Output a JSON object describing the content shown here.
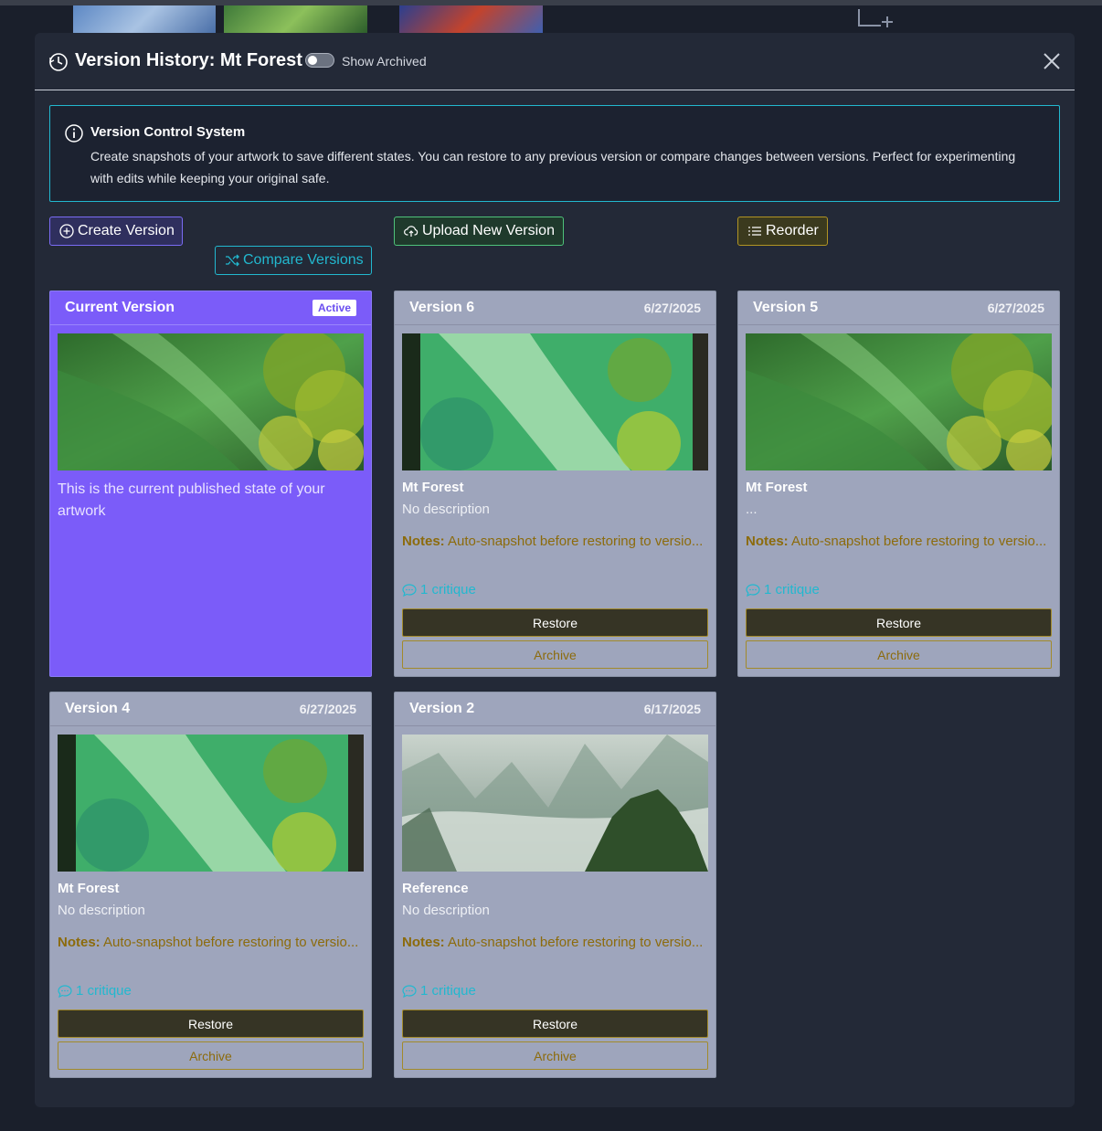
{
  "header": {
    "title": "Version History: Mt Forest",
    "toggle_label": "Show Archived",
    "toggle_on": false
  },
  "info": {
    "title": "Version Control System",
    "text": "Create snapshots of your artwork to save different states. You can restore to any previous version or compare changes between versions. Perfect for experimenting with edits while keeping your original safe."
  },
  "toolbar": {
    "create_label": "Create Version",
    "compare_label": "Compare Versions",
    "upload_label": "Upload New Version",
    "reorder_label": "Reorder"
  },
  "current": {
    "title": "Current Version",
    "badge": "Active",
    "description": "This is the current published state of your artwork"
  },
  "versions": [
    {
      "title": "Version 6",
      "date": "6/27/2025",
      "name": "Mt Forest",
      "description": "No description",
      "notes_label": "Notes:",
      "notes": "Auto-snapshot before restoring to versio...",
      "critiques": "1 critique",
      "restore": "Restore",
      "archive": "Archive"
    },
    {
      "title": "Version 5",
      "date": "6/27/2025",
      "name": "Mt Forest",
      "description": "...",
      "notes_label": "Notes:",
      "notes": "Auto-snapshot before restoring to versio...",
      "critiques": "1 critique",
      "restore": "Restore",
      "archive": "Archive"
    },
    {
      "title": "Version 4",
      "date": "6/27/2025",
      "name": "Mt Forest",
      "description": "No description",
      "notes_label": "Notes:",
      "notes": "Auto-snapshot before restoring to versio...",
      "critiques": "1 critique",
      "restore": "Restore",
      "archive": "Archive"
    },
    {
      "title": "Version 2",
      "date": "6/17/2025",
      "name": "Reference",
      "description": "No description",
      "notes_label": "Notes:",
      "notes": "Auto-snapshot before restoring to versio...",
      "critiques": "1 critique",
      "restore": "Restore",
      "archive": "Archive"
    }
  ],
  "colors": {
    "accent": "#7b5cf9",
    "cyan": "#22b8cf",
    "green": "#4ec27a",
    "gold": "#b19424"
  }
}
